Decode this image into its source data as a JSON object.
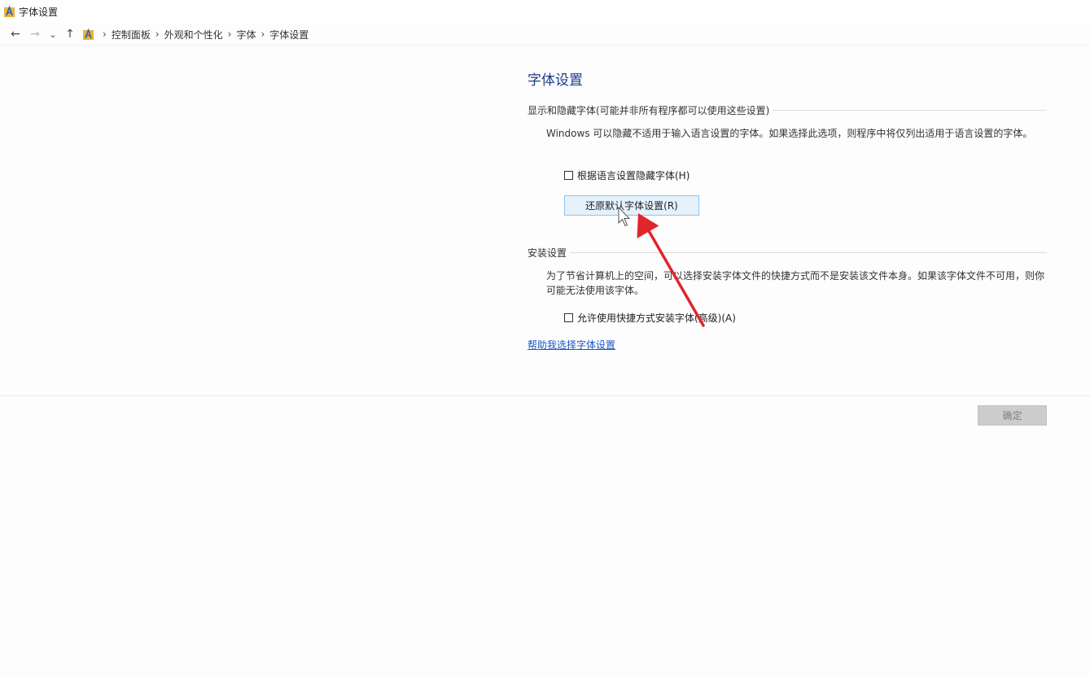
{
  "window": {
    "title": "字体设置",
    "icon": "fonts-folder-icon"
  },
  "nav": {
    "back_icon": "←",
    "forward_icon": "→",
    "recent_icon": "⌄",
    "up_icon": "↑",
    "separator": "›",
    "breadcrumbs": [
      "控制面板",
      "外观和个性化",
      "字体",
      "字体设置"
    ]
  },
  "page": {
    "title": "字体设置",
    "show_hide_section": {
      "header": "显示和隐藏字体(可能并非所有程序都可以使用这些设置)",
      "description": "Windows 可以隐藏不适用于输入语言设置的字体。如果选择此选项，则程序中将仅列出适用于语言设置的字体。",
      "checkbox_label": "根据语言设置隐藏字体(H)",
      "checkbox_checked": false,
      "restore_button": "还原默认字体设置(R)"
    },
    "install_section": {
      "header": "安装设置",
      "description": "为了节省计算机上的空间，可以选择安装字体文件的快捷方式而不是安装该文件本身。如果该字体文件不可用，则你可能无法使用该字体。",
      "checkbox_label": "允许使用快捷方式安装字体(高级)(A)",
      "checkbox_checked": false
    },
    "help_link": "帮助我选择字体设置"
  },
  "footer": {
    "ok_button": "确定"
  },
  "colors": {
    "title_blue": "#1e3a8a",
    "link_blue": "#1a56c7",
    "annotation_red": "#e0262b",
    "button_hover_bg": "#e5f1fb"
  }
}
